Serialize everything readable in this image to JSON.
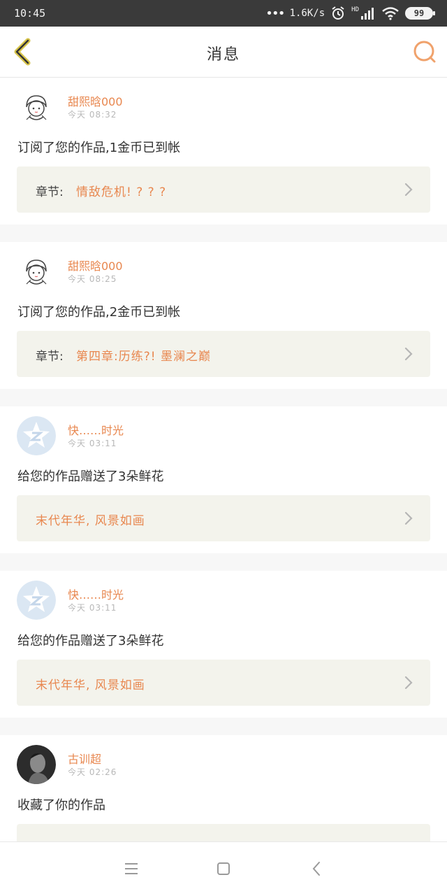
{
  "status_bar": {
    "time": "10:45",
    "net_speed": "1.6K/s",
    "network_type": "HD",
    "battery": "99",
    "icons": [
      "dots-icon",
      "alarm-icon",
      "signal-icon",
      "wifi-icon",
      "battery-icon"
    ]
  },
  "nav": {
    "title": "消息",
    "back_icon": "back-chevron-icon",
    "search_icon": "search-icon",
    "accent_color": "#e8874f"
  },
  "messages": [
    {
      "sender": "甜熙晗000",
      "time": "今天 08:32",
      "text": "订阅了您的作品,1金币已到帐",
      "link_label": "章节:",
      "link_text": "情敌危机! ? ? ?",
      "avatar": "girl-sketch-avatar"
    },
    {
      "sender": "甜熙晗000",
      "time": "今天 08:25",
      "text": "订阅了您的作品,2金币已到帐",
      "link_label": "章节:",
      "link_text": "第四章:历练?! 墨澜之巅",
      "avatar": "girl-sketch-avatar"
    },
    {
      "sender": "快……时光",
      "time": "今天 03:11",
      "text": "给您的作品赠送了3朵鲜花",
      "link_label": "",
      "link_text": "末代年华, 风景如画",
      "avatar": "default-star-avatar"
    },
    {
      "sender": "快……时光",
      "time": "今天 03:11",
      "text": "给您的作品赠送了3朵鲜花",
      "link_label": "",
      "link_text": "末代年华, 风景如画",
      "avatar": "default-star-avatar"
    },
    {
      "sender": "古训超",
      "time": "今天 02:26",
      "text": "收藏了你的作品",
      "link_label": "",
      "link_text": "",
      "avatar": "photo-avatar"
    }
  ],
  "bottom_bar": {
    "icons": [
      "menu-icon",
      "home-square-icon",
      "back-triangle-icon"
    ]
  }
}
